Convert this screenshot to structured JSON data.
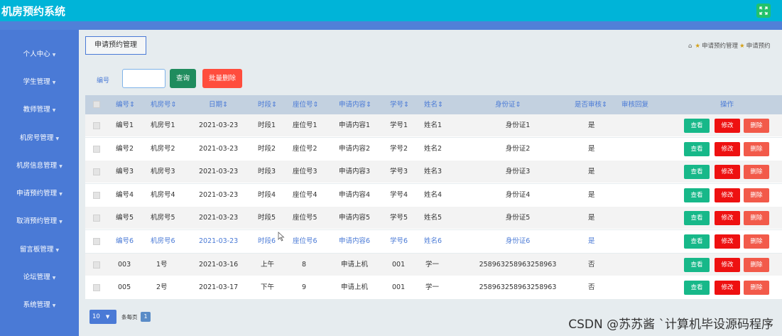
{
  "app": {
    "title": "机房预约系统"
  },
  "sidebar": {
    "items": [
      {
        "label": "个人中心"
      },
      {
        "label": "学生管理"
      },
      {
        "label": "教师管理"
      },
      {
        "label": "机房号管理"
      },
      {
        "label": "机房信息管理"
      },
      {
        "label": "申请预约管理"
      },
      {
        "label": "取消预约管理"
      },
      {
        "label": "留言板管理"
      },
      {
        "label": "论坛管理"
      },
      {
        "label": "系统管理"
      }
    ]
  },
  "page": {
    "tab_label": "申请预约管理",
    "breadcrumb": [
      "申请预约管理",
      "申请预约"
    ]
  },
  "search": {
    "label": "编号",
    "value": "",
    "query_button": "查询",
    "batch_delete_button": "批量删除"
  },
  "table": {
    "headers": [
      "编号",
      "机房号",
      "日期",
      "时段",
      "座位号",
      "申请内容",
      "学号",
      "姓名",
      "身份证",
      "是否审核",
      "审核回复",
      "操作"
    ],
    "sort_icon": "sort-icon",
    "rows": [
      {
        "id": "编号1",
        "room": "机房号1",
        "date": "2021-03-23",
        "slot": "时段1",
        "seat": "座位号1",
        "content": "申请内容1",
        "sid": "学号1",
        "name": "姓名1",
        "idcard": "身份证1",
        "audit": "是",
        "reply": ""
      },
      {
        "id": "编号2",
        "room": "机房号2",
        "date": "2021-03-23",
        "slot": "时段2",
        "seat": "座位号2",
        "content": "申请内容2",
        "sid": "学号2",
        "name": "姓名2",
        "idcard": "身份证2",
        "audit": "是",
        "reply": ""
      },
      {
        "id": "编号3",
        "room": "机房号3",
        "date": "2021-03-23",
        "slot": "时段3",
        "seat": "座位号3",
        "content": "申请内容3",
        "sid": "学号3",
        "name": "姓名3",
        "idcard": "身份证3",
        "audit": "是",
        "reply": ""
      },
      {
        "id": "编号4",
        "room": "机房号4",
        "date": "2021-03-23",
        "slot": "时段4",
        "seat": "座位号4",
        "content": "申请内容4",
        "sid": "学号4",
        "name": "姓名4",
        "idcard": "身份证4",
        "audit": "是",
        "reply": ""
      },
      {
        "id": "编号5",
        "room": "机房号5",
        "date": "2021-03-23",
        "slot": "时段5",
        "seat": "座位号5",
        "content": "申请内容5",
        "sid": "学号5",
        "name": "姓名5",
        "idcard": "身份证5",
        "audit": "是",
        "reply": ""
      },
      {
        "id": "编号6",
        "room": "机房号6",
        "date": "2021-03-23",
        "slot": "时段6",
        "seat": "座位号6",
        "content": "申请内容6",
        "sid": "学号6",
        "name": "姓名6",
        "idcard": "身份证6",
        "audit": "是",
        "reply": ""
      },
      {
        "id": "003",
        "room": "1号",
        "date": "2021-03-16",
        "slot": "上午",
        "seat": "8",
        "content": "申请上机",
        "sid": "001",
        "name": "学一",
        "idcard": "258963258963258963",
        "audit": "否",
        "reply": ""
      },
      {
        "id": "005",
        "room": "2号",
        "date": "2021-03-17",
        "slot": "下午",
        "seat": "9",
        "content": "申请上机",
        "sid": "001",
        "name": "学一",
        "idcard": "258963258963258963",
        "audit": "否",
        "reply": ""
      }
    ],
    "actions": {
      "view": "查看",
      "edit": "修改",
      "delete": "删除"
    }
  },
  "pager": {
    "page_size": "10",
    "per_page_label": "条每页",
    "current_page": "1"
  },
  "watermark": "CSDN @苏苏酱  `计算机毕设源码程序",
  "colors": {
    "topbar": "#00b4d8",
    "sidebar": "#4a7ad6",
    "view": "#17b889",
    "edit": "#ee1111",
    "delete": "#f25a4a"
  }
}
